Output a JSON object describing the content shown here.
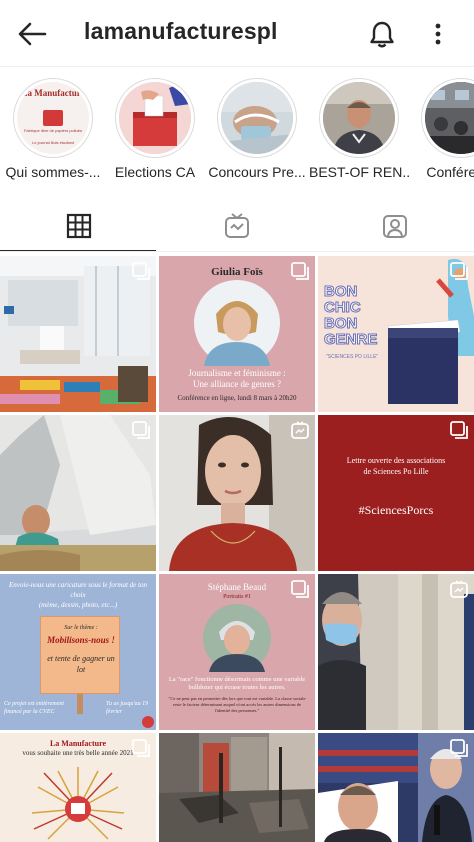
{
  "header": {
    "back_icon": "arrow-left-icon",
    "username": "lamanufacturespl",
    "bell_icon": "bell-icon",
    "more_icon": "more-vertical-icon"
  },
  "highlights": [
    {
      "label": "Qui sommes-...",
      "cover_brand": "La Manufacture",
      "cover_tagline": "Fabrique libre de papiers pollués",
      "cover_footer": "Le journal lilois\nétudiant"
    },
    {
      "label": "Elections CA"
    },
    {
      "label": "Concours Pre..."
    },
    {
      "label": "BEST-OF REN..."
    },
    {
      "label": "Conféren..."
    }
  ],
  "tabs": [
    {
      "name": "grid",
      "icon": "grid-icon",
      "selected": true
    },
    {
      "name": "igtv",
      "icon": "igtv-icon",
      "selected": false
    },
    {
      "name": "tagged",
      "icon": "tagged-user-icon",
      "selected": false
    }
  ],
  "posts": {
    "p2": {
      "name": "Giulia Foïs",
      "title": "Journalisme et féminisme :\nUne alliance de genres ?",
      "sub": "Conférence en ligne, lundi 8 mars à 20h20"
    },
    "p3": {
      "line1": "BON",
      "line2": "CHIC",
      "line3": "BON",
      "line4": "GENRE",
      "small": "\"SCIENCES PO LILLE\""
    },
    "p6": {
      "line1": "Lettre ouverte des associations",
      "line2": "de Sciences Po Lille",
      "tag": "#SciencesPorcs"
    },
    "p7": {
      "top": "Envoie-nous une caricature sous le format de ton choix\n(mème, dessin, photo, etc...)",
      "theme_label": "Sur le thème :",
      "theme": "Mobilisons-nous !",
      "prize": "et tente de gagner un lot",
      "left_note": "Ce projet est entièrement financé par la CVEC",
      "right_note": "Tu as jusqu'au 19 février"
    },
    "p8": {
      "name": "Stéphane Beaud",
      "portrait": "Portraits #1",
      "quote": "La \"race\" fonctionne désormais comme une variable bulldozer qui écrase toutes les autres.",
      "small": "\"Ce ne peut pas en permettre dès lors que tout est variable. La classe sociale reste le facteur déterminant auquel n'ont accès les autres dimensions de l'identité des personnes.\""
    },
    "p10": {
      "line1": "La Manufacture",
      "line2": "vous souhaite une très belle année 2021"
    }
  },
  "colors": {
    "text": "#262626",
    "divider": "#efefef",
    "pink": "#d9a6ab",
    "crimson": "#9c1f1f",
    "navy": "#27304f"
  }
}
